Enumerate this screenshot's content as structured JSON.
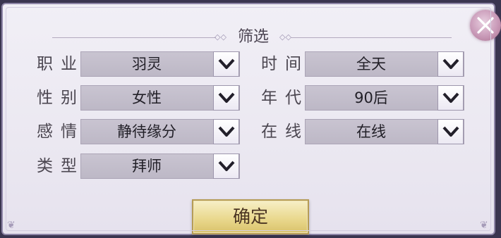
{
  "dialog": {
    "title": "筛选",
    "confirm_label": "确定"
  },
  "filters": {
    "profession": {
      "label": "职业",
      "value": "羽灵"
    },
    "gender": {
      "label": "性别",
      "value": "女性"
    },
    "relationship": {
      "label": "感情",
      "value": "静待缘分"
    },
    "type": {
      "label": "类型",
      "value": "拜师"
    },
    "time": {
      "label": "时间",
      "value": "全天"
    },
    "era": {
      "label": "年代",
      "value": "90后"
    },
    "online": {
      "label": "在线",
      "value": "在线"
    }
  },
  "colors": {
    "panel_bg": "#ebe8f1",
    "select_bg": "#c3bece",
    "confirm_gold": "#ead98f",
    "close_pink": "#c99ab8"
  },
  "icons": [
    "close-icon",
    "chevron-down-icon",
    "diamond-ornament-icon"
  ]
}
